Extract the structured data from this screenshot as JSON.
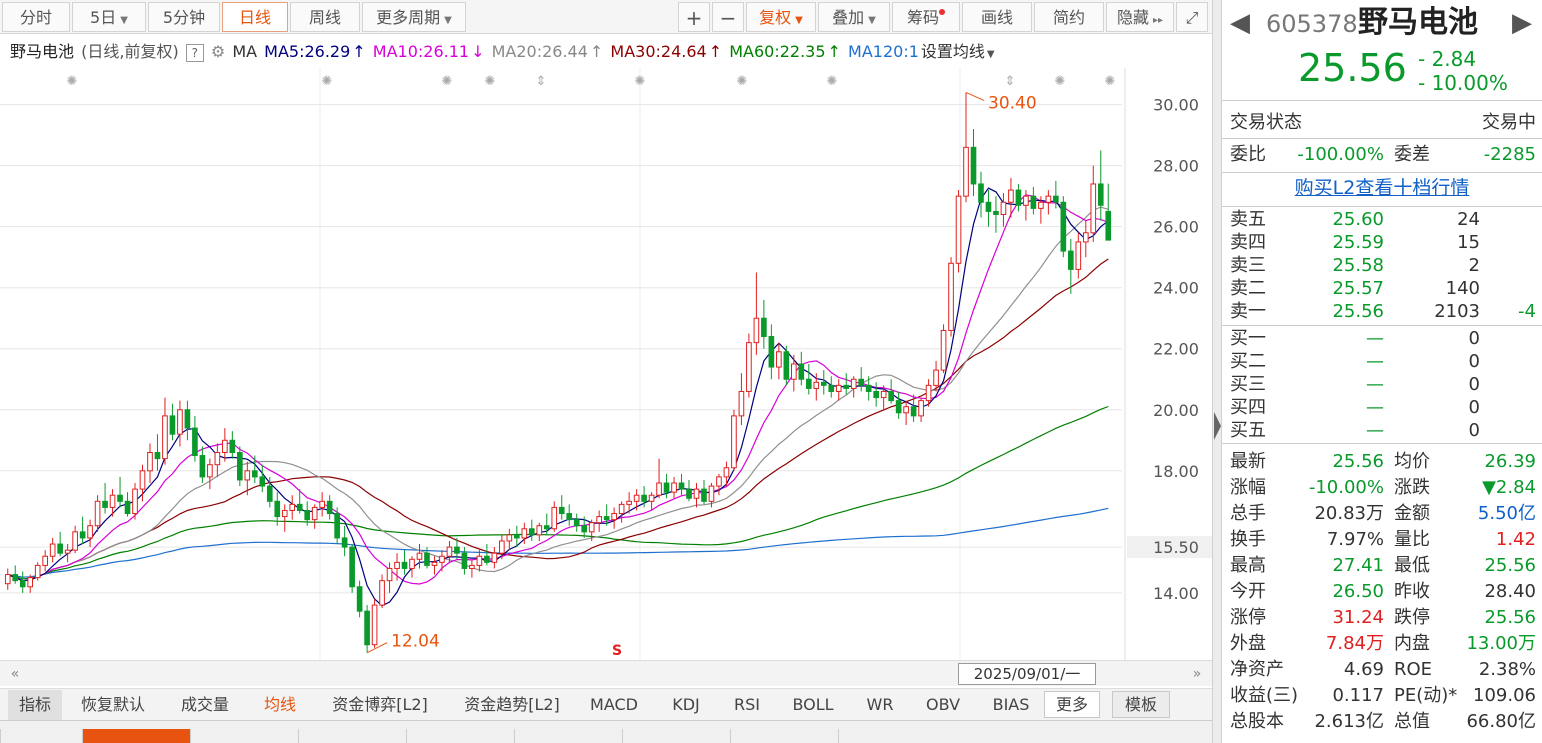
{
  "toolbar": {
    "tabs": [
      "分时",
      "5日",
      "5分钟",
      "日线",
      "周线",
      "更多周期"
    ],
    "active_tab": "日线",
    "right_buttons": [
      "+",
      "−",
      "复权",
      "叠加",
      "筹码",
      "画线",
      "简约",
      "隐藏"
    ]
  },
  "ma_bar": {
    "name": "野马电池",
    "mode": "(日线,前复权)",
    "help": "?",
    "ma_label": "MA",
    "ma5": "MA5:26.29",
    "ma5_arrow": "↑",
    "ma10": "MA10:26.11",
    "ma10_arrow": "↓",
    "ma20": "MA20:26.44",
    "ma20_arrow": "↑",
    "ma30": "MA30:24.64",
    "ma30_arrow": "↑",
    "ma60": "MA60:22.35",
    "ma60_arrow": "↑",
    "ma120": "MA120:1",
    "set_ma": "设置均线",
    "colors": {
      "ma5": "#000080",
      "ma10": "#d800d8",
      "ma20": "#909090",
      "ma30": "#8b0000",
      "ma60": "#008000",
      "ma120": "#1e6fd0",
      "up": "#e02020",
      "down": "#0a9a2c",
      "marker": "#e8540f"
    }
  },
  "chart": {
    "y_ticks": [
      "30.00",
      "28.00",
      "26.00",
      "24.00",
      "22.00",
      "20.00",
      "18.00",
      "15.50",
      "14.00"
    ],
    "high_label": "30.40",
    "low_label": "12.04"
  },
  "chart_data": {
    "type": "candlestick",
    "ylim": [
      11.8,
      31.2
    ],
    "y_ticks": [
      30,
      28,
      26,
      24,
      22,
      20,
      18,
      15.5,
      14
    ],
    "ohlc": [
      [
        14.3,
        14.8,
        14.1,
        14.6
      ],
      [
        14.6,
        14.9,
        14.3,
        14.4
      ],
      [
        14.4,
        14.7,
        14.0,
        14.2
      ],
      [
        14.2,
        14.6,
        14.0,
        14.5
      ],
      [
        14.5,
        15.0,
        14.4,
        14.9
      ],
      [
        14.9,
        15.4,
        14.7,
        15.2
      ],
      [
        15.2,
        15.8,
        15.0,
        15.6
      ],
      [
        15.6,
        16.0,
        15.2,
        15.3
      ],
      [
        15.3,
        15.6,
        15.0,
        15.4
      ],
      [
        15.4,
        16.2,
        15.3,
        16.0
      ],
      [
        16.0,
        16.5,
        15.6,
        15.8
      ],
      [
        15.8,
        16.4,
        15.5,
        16.2
      ],
      [
        16.2,
        17.2,
        16.0,
        17.0
      ],
      [
        17.0,
        17.6,
        16.6,
        16.8
      ],
      [
        16.8,
        17.4,
        16.5,
        17.2
      ],
      [
        17.2,
        17.8,
        16.8,
        17.0
      ],
      [
        17.0,
        17.3,
        16.5,
        16.6
      ],
      [
        16.6,
        17.6,
        16.4,
        17.4
      ],
      [
        17.4,
        18.2,
        17.0,
        18.0
      ],
      [
        18.0,
        18.9,
        17.6,
        18.6
      ],
      [
        18.6,
        19.2,
        18.0,
        18.4
      ],
      [
        18.4,
        20.4,
        18.2,
        19.8
      ],
      [
        19.8,
        20.2,
        19.0,
        19.2
      ],
      [
        19.2,
        20.3,
        18.8,
        20.0
      ],
      [
        20.0,
        20.3,
        19.0,
        19.4
      ],
      [
        19.4,
        19.8,
        18.3,
        18.5
      ],
      [
        18.5,
        18.8,
        17.6,
        17.8
      ],
      [
        17.8,
        18.4,
        17.4,
        18.2
      ],
      [
        18.2,
        18.9,
        17.8,
        18.6
      ],
      [
        18.6,
        19.4,
        18.3,
        19.0
      ],
      [
        19.0,
        19.3,
        18.4,
        18.6
      ],
      [
        18.6,
        18.8,
        17.5,
        17.7
      ],
      [
        17.7,
        18.3,
        17.2,
        18.0
      ],
      [
        18.0,
        18.5,
        17.6,
        17.8
      ],
      [
        17.8,
        18.2,
        17.3,
        17.5
      ],
      [
        17.5,
        17.8,
        16.8,
        17.0
      ],
      [
        17.0,
        17.3,
        16.2,
        16.5
      ],
      [
        16.5,
        16.9,
        16.0,
        16.7
      ],
      [
        16.7,
        17.2,
        16.4,
        16.9
      ],
      [
        16.9,
        17.4,
        16.6,
        16.7
      ],
      [
        16.7,
        17.0,
        16.2,
        16.4
      ],
      [
        16.4,
        16.9,
        16.1,
        16.8
      ],
      [
        16.8,
        17.3,
        16.5,
        17.0
      ],
      [
        17.0,
        17.2,
        16.4,
        16.6
      ],
      [
        16.6,
        16.8,
        15.6,
        15.8
      ],
      [
        15.8,
        16.2,
        15.2,
        15.5
      ],
      [
        15.5,
        15.6,
        14.0,
        14.2
      ],
      [
        14.2,
        14.4,
        13.2,
        13.4
      ],
      [
        13.4,
        13.6,
        12.04,
        12.3
      ],
      [
        12.3,
        13.8,
        12.2,
        13.6
      ],
      [
        13.6,
        14.6,
        13.5,
        14.4
      ],
      [
        14.4,
        15.0,
        14.0,
        14.8
      ],
      [
        14.8,
        15.3,
        14.4,
        15.0
      ],
      [
        15.0,
        15.4,
        14.6,
        14.8
      ],
      [
        14.8,
        15.2,
        14.5,
        15.1
      ],
      [
        15.1,
        15.6,
        14.8,
        15.3
      ],
      [
        15.3,
        15.5,
        14.8,
        14.9
      ],
      [
        14.9,
        15.2,
        14.6,
        15.0
      ],
      [
        15.0,
        15.4,
        14.7,
        15.2
      ],
      [
        15.2,
        15.7,
        15.0,
        15.5
      ],
      [
        15.5,
        15.8,
        15.1,
        15.3
      ],
      [
        15.3,
        15.5,
        14.6,
        14.8
      ],
      [
        14.8,
        15.1,
        14.5,
        14.9
      ],
      [
        14.9,
        15.4,
        14.7,
        15.2
      ],
      [
        15.2,
        15.6,
        14.9,
        15.0
      ],
      [
        15.0,
        15.5,
        14.8,
        15.3
      ],
      [
        15.3,
        15.9,
        15.1,
        15.7
      ],
      [
        15.7,
        16.1,
        15.4,
        15.9
      ],
      [
        15.9,
        16.2,
        15.5,
        15.8
      ],
      [
        15.8,
        16.3,
        15.6,
        16.1
      ],
      [
        16.1,
        16.4,
        15.7,
        15.9
      ],
      [
        15.9,
        16.3,
        15.7,
        16.2
      ],
      [
        16.2,
        16.6,
        15.9,
        16.1
      ],
      [
        16.1,
        17.0,
        16.0,
        16.8
      ],
      [
        16.8,
        17.2,
        16.4,
        16.6
      ],
      [
        16.6,
        16.9,
        16.2,
        16.4
      ],
      [
        16.4,
        16.6,
        16.0,
        16.2
      ],
      [
        16.2,
        16.5,
        15.8,
        16.0
      ],
      [
        16.0,
        16.4,
        15.7,
        16.3
      ],
      [
        16.3,
        16.7,
        16.0,
        16.5
      ],
      [
        16.5,
        16.9,
        16.2,
        16.4
      ],
      [
        16.4,
        16.8,
        16.1,
        16.6
      ],
      [
        16.6,
        17.0,
        16.3,
        16.9
      ],
      [
        16.9,
        17.3,
        16.6,
        17.0
      ],
      [
        17.0,
        17.4,
        16.7,
        17.2
      ],
      [
        17.2,
        17.5,
        16.8,
        17.0
      ],
      [
        17.0,
        17.3,
        16.7,
        17.2
      ],
      [
        17.2,
        18.4,
        17.1,
        17.6
      ],
      [
        17.6,
        17.9,
        17.1,
        17.3
      ],
      [
        17.3,
        17.8,
        17.1,
        17.6
      ],
      [
        17.6,
        17.9,
        17.2,
        17.4
      ],
      [
        17.4,
        17.7,
        17.0,
        17.1
      ],
      [
        17.1,
        17.6,
        16.8,
        17.4
      ],
      [
        17.4,
        17.7,
        16.9,
        17.0
      ],
      [
        17.0,
        17.6,
        16.8,
        17.5
      ],
      [
        17.5,
        17.9,
        17.2,
        17.8
      ],
      [
        17.8,
        18.3,
        17.5,
        18.1
      ],
      [
        18.1,
        20.0,
        18.0,
        19.8
      ],
      [
        19.8,
        21.2,
        19.5,
        20.6
      ],
      [
        20.6,
        22.5,
        20.4,
        22.2
      ],
      [
        22.2,
        24.5,
        21.8,
        23.0
      ],
      [
        23.0,
        23.6,
        22.0,
        22.4
      ],
      [
        22.4,
        22.8,
        21.0,
        21.4
      ],
      [
        21.4,
        22.2,
        21.0,
        21.9
      ],
      [
        21.9,
        22.1,
        20.8,
        21.0
      ],
      [
        21.0,
        21.8,
        20.6,
        21.5
      ],
      [
        21.5,
        21.9,
        20.8,
        21.0
      ],
      [
        21.0,
        21.5,
        20.5,
        20.7
      ],
      [
        20.7,
        21.2,
        20.3,
        20.9
      ],
      [
        20.9,
        21.3,
        20.5,
        20.8
      ],
      [
        20.8,
        21.1,
        20.4,
        20.6
      ],
      [
        20.6,
        21.0,
        20.3,
        20.8
      ],
      [
        20.8,
        21.2,
        20.5,
        20.7
      ],
      [
        20.7,
        21.1,
        20.4,
        21.0
      ],
      [
        21.0,
        21.4,
        20.6,
        20.8
      ],
      [
        20.8,
        21.1,
        20.3,
        20.6
      ],
      [
        20.6,
        20.9,
        20.1,
        20.4
      ],
      [
        20.4,
        20.8,
        20.0,
        20.6
      ],
      [
        20.6,
        21.0,
        20.2,
        20.3
      ],
      [
        20.3,
        20.6,
        19.7,
        19.9
      ],
      [
        19.9,
        20.3,
        19.5,
        20.1
      ],
      [
        20.1,
        20.5,
        19.6,
        19.8
      ],
      [
        19.8,
        20.4,
        19.6,
        20.3
      ],
      [
        20.3,
        21.0,
        20.1,
        20.8
      ],
      [
        20.8,
        21.6,
        20.6,
        21.3
      ],
      [
        21.3,
        22.8,
        21.2,
        22.6
      ],
      [
        22.6,
        25.0,
        22.4,
        24.8
      ],
      [
        24.8,
        27.2,
        24.5,
        27.0
      ],
      [
        27.0,
        30.4,
        26.8,
        28.6
      ],
      [
        28.6,
        29.2,
        27.0,
        27.4
      ],
      [
        27.4,
        27.8,
        26.3,
        26.8
      ],
      [
        26.8,
        27.2,
        26.0,
        26.5
      ],
      [
        26.5,
        27.0,
        25.8,
        26.4
      ],
      [
        26.4,
        27.1,
        26.0,
        26.8
      ],
      [
        26.8,
        27.6,
        26.3,
        27.2
      ],
      [
        27.2,
        27.4,
        26.5,
        26.7
      ],
      [
        26.7,
        27.2,
        26.2,
        27.0
      ],
      [
        27.0,
        27.3,
        26.4,
        26.6
      ],
      [
        26.6,
        27.0,
        26.1,
        26.8
      ],
      [
        26.8,
        27.2,
        26.4,
        27.0
      ],
      [
        27.0,
        27.5,
        26.6,
        26.8
      ],
      [
        26.8,
        27.0,
        25.0,
        25.2
      ],
      [
        25.2,
        25.6,
        23.8,
        24.6
      ],
      [
        24.6,
        25.8,
        24.3,
        25.5
      ],
      [
        25.5,
        26.2,
        25.0,
        25.8
      ],
      [
        25.8,
        28.0,
        25.5,
        27.4
      ],
      [
        27.4,
        28.5,
        26.2,
        26.7
      ],
      [
        26.5,
        27.41,
        25.56,
        25.56
      ]
    ]
  },
  "right_panel": {
    "code": "605378",
    "name": "野马电池",
    "price": "25.56",
    "change": "- 2.84",
    "pct": "- 10.00%",
    "status_label": "交易状态",
    "status_value": "交易中",
    "webi_label": "委比",
    "webi_value": "-100.00%",
    "weicha_label": "委差",
    "weicha_value": "-2285",
    "buy_l2": "购买L2查看十档行情",
    "asks": [
      {
        "label": "卖五",
        "price": "25.60",
        "vol": "24",
        "delta": ""
      },
      {
        "label": "卖四",
        "price": "25.59",
        "vol": "15",
        "delta": ""
      },
      {
        "label": "卖三",
        "price": "25.58",
        "vol": "2",
        "delta": ""
      },
      {
        "label": "卖二",
        "price": "25.57",
        "vol": "140",
        "delta": ""
      },
      {
        "label": "卖一",
        "price": "25.56",
        "vol": "2103",
        "delta": "-4"
      }
    ],
    "bids": [
      {
        "label": "买一",
        "price": "—",
        "vol": "0"
      },
      {
        "label": "买二",
        "price": "—",
        "vol": "0"
      },
      {
        "label": "买三",
        "price": "—",
        "vol": "0"
      },
      {
        "label": "买四",
        "price": "—",
        "vol": "0"
      },
      {
        "label": "买五",
        "price": "—",
        "vol": "0"
      }
    ],
    "stats": [
      {
        "l1": "最新",
        "v1": "25.56",
        "c1": "g",
        "l2": "均价",
        "v2": "26.39",
        "c2": "g"
      },
      {
        "l1": "涨幅",
        "v1": "-10.00%",
        "c1": "g",
        "l2": "涨跌",
        "v2": "▼2.84",
        "c2": "g"
      },
      {
        "l1": "总手",
        "v1": "20.83万",
        "c1": "",
        "l2": "金额",
        "v2": "5.50亿",
        "c2": "blue"
      },
      {
        "l1": "换手",
        "v1": "7.97%",
        "c1": "",
        "l2": "量比",
        "v2": "1.42",
        "c2": "r"
      },
      {
        "l1": "最高",
        "v1": "27.41",
        "c1": "g",
        "l2": "最低",
        "v2": "25.56",
        "c2": "g"
      },
      {
        "l1": "今开",
        "v1": "26.50",
        "c1": "g",
        "l2": "昨收",
        "v2": "28.40",
        "c2": ""
      },
      {
        "l1": "涨停",
        "v1": "31.24",
        "c1": "r",
        "l2": "跌停",
        "v2": "25.56",
        "c2": "g"
      },
      {
        "l1": "外盘",
        "v1": "7.84万",
        "c1": "r",
        "l2": "内盘",
        "v2": "13.00万",
        "c2": "g"
      },
      {
        "l1": "净资产",
        "v1": "4.69",
        "c1": "",
        "l2": "ROE",
        "v2": "2.38%",
        "c2": ""
      },
      {
        "l1": "收益(三)",
        "v1": "0.117",
        "c1": "",
        "l2": "PE(动)*",
        "v2": "109.06",
        "c2": ""
      },
      {
        "l1": "总股本",
        "v1": "2.613亿",
        "c1": "",
        "l2": "总值",
        "v2": "66.80亿",
        "c2": ""
      }
    ]
  },
  "scroll": {
    "date": "2025/09/01/一"
  },
  "indicators": {
    "tabs": [
      "指标",
      "恢复默认",
      "成交量",
      "均线",
      "资金博弈[L2]",
      "资金趋势[L2]",
      "MACD",
      "KDJ",
      "RSI",
      "BOLL",
      "WR",
      "OBV",
      "BIAS",
      "更多",
      "模板"
    ],
    "active": "均线"
  }
}
